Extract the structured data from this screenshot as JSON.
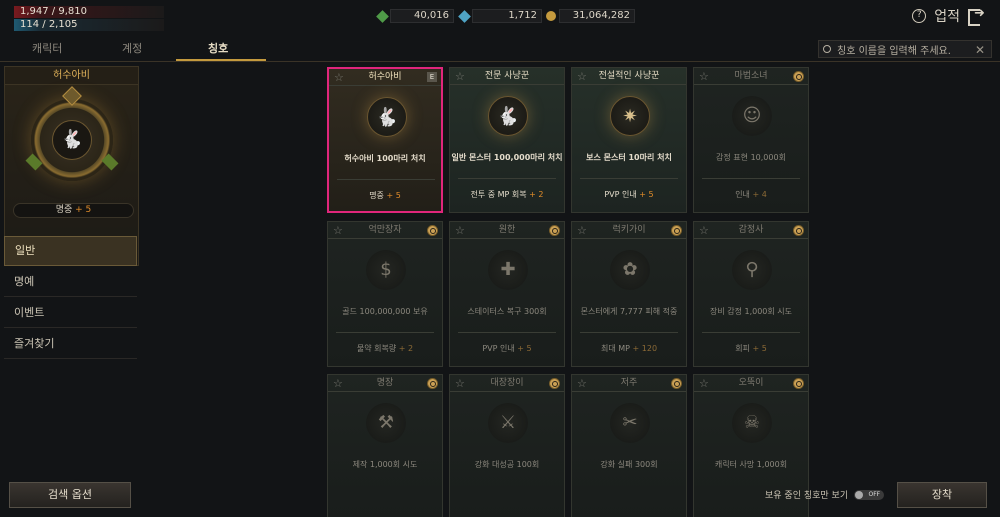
{
  "stats": {
    "hp": "1,947 / 9,810",
    "mp": "114 / 2,105"
  },
  "currency": [
    {
      "icon": "green-gem-icon",
      "value": "40,016",
      "color": "#4f9a48"
    },
    {
      "icon": "blue-gem-icon",
      "value": "1,712",
      "color": "#4fa3c4"
    },
    {
      "icon": "gold-coin-icon",
      "value": "31,064,282",
      "color": "#c49a3e"
    }
  ],
  "header": {
    "achievements_label": "업적"
  },
  "tabs": [
    {
      "label": "캐릭터"
    },
    {
      "label": "계정"
    },
    {
      "label": "칭호"
    }
  ],
  "search": {
    "placeholder": "칭호 이름을 입력해 주세요."
  },
  "selected_title": {
    "name": "허수아비",
    "stat_label": "명중",
    "stat_value": "+ 5"
  },
  "menu": [
    {
      "label": "일반"
    },
    {
      "label": "명예"
    },
    {
      "label": "이벤트"
    },
    {
      "label": "즐겨찾기"
    }
  ],
  "cards": [
    {
      "title": "허수아비",
      "desc": "허수아비 100마리 처치",
      "stat": "명중",
      "bonus": "+ 5",
      "icon": "rabbit-icon",
      "badge": "E"
    },
    {
      "title": "전문 사냥꾼",
      "desc": "일반 몬스터 100,000마리 처치",
      "stat": "전투 중 MP 회복",
      "bonus": "+ 2",
      "icon": "rabbit-icon"
    },
    {
      "title": "전설적인 사냥꾼",
      "desc": "보스 몬스터 10마리 처치",
      "stat": "PVP 인내",
      "bonus": "+ 5",
      "icon": "boss-emblem-icon"
    },
    {
      "title": "마법소녀",
      "desc": "감정 표현 10,000회",
      "stat": "인내",
      "bonus": "+ 4",
      "icon": "smile-icon"
    },
    {
      "title": "억만장자",
      "desc": "골드 100,000,000 보유",
      "stat": "물약 회복량",
      "bonus": "+ 2",
      "icon": "money-bag-icon"
    },
    {
      "title": "원한",
      "desc": "스테이터스 복구 300회",
      "stat": "PVP 인내",
      "bonus": "+ 5",
      "icon": "cross-shield-icon"
    },
    {
      "title": "럭키가이",
      "desc": "몬스터에게 7,777 피해 적중",
      "stat": "최대 MP",
      "bonus": "+ 120",
      "icon": "lucky-emblem-icon"
    },
    {
      "title": "감정사",
      "desc": "장비 감정 1,000회 시도",
      "stat": "회피",
      "bonus": "+ 5",
      "icon": "magnifier-icon"
    },
    {
      "title": "명장",
      "desc": "제작 1,000회 시도",
      "stat": "",
      "bonus": "",
      "icon": "craft-icon"
    },
    {
      "title": "대장장이",
      "desc": "강화 대성공 100회",
      "stat": "",
      "bonus": "",
      "icon": "anvil-icon"
    },
    {
      "title": "저주",
      "desc": "강화 실패 300회",
      "stat": "",
      "bonus": "",
      "icon": "broken-sword-icon"
    },
    {
      "title": "오뚝이",
      "desc": "캐릭터 사망 1,000회",
      "stat": "",
      "bonus": "",
      "icon": "skull-icon"
    }
  ],
  "footer": {
    "search_options_label": "검색 옵션",
    "owned_only_label": "보유 중인 칭호만 보기",
    "toggle_state": "OFF",
    "equip_label": "장착"
  }
}
